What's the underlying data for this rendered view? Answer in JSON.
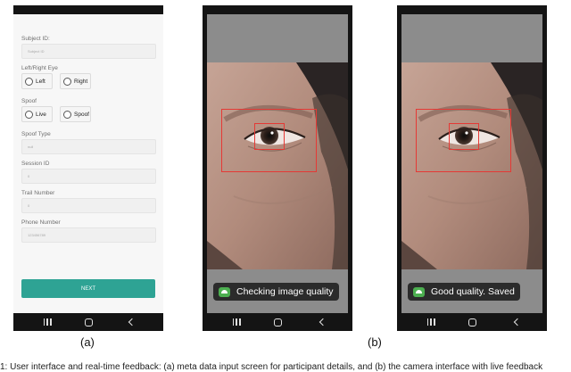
{
  "form_screen": {
    "subject_id": {
      "label": "Subject ID:",
      "placeholder": "Subject ID"
    },
    "eye": {
      "label": "Left/Right Eye",
      "options": [
        "Left",
        "Right"
      ]
    },
    "spoof": {
      "label": "Spoof",
      "options": [
        "Live",
        "Spoof"
      ]
    },
    "spoof_type": {
      "label": "Spoof Type",
      "placeholder": "null"
    },
    "session_id": {
      "label": "Session ID",
      "placeholder": "0"
    },
    "trail_number": {
      "label": "Trail Number",
      "placeholder": "0"
    },
    "phone_number": {
      "label": "Phone Number",
      "placeholder": "123456789"
    },
    "next_button": "NEXT",
    "accent_color": "#2ea394"
  },
  "camera_screens": [
    {
      "toast": "Checking image quality",
      "icon": "android-icon"
    },
    {
      "toast": "Good quality. Saved",
      "icon": "android-icon"
    }
  ],
  "detection_box_color": "#e53935",
  "nav_icons": [
    "recents-icon",
    "home-icon",
    "back-icon"
  ],
  "captions": {
    "a": "(a)",
    "b": "(b)"
  },
  "footnote": "1: User interface and real-time feedback: (a) meta data input screen for participant details, and (b) the camera interface with live feedback"
}
